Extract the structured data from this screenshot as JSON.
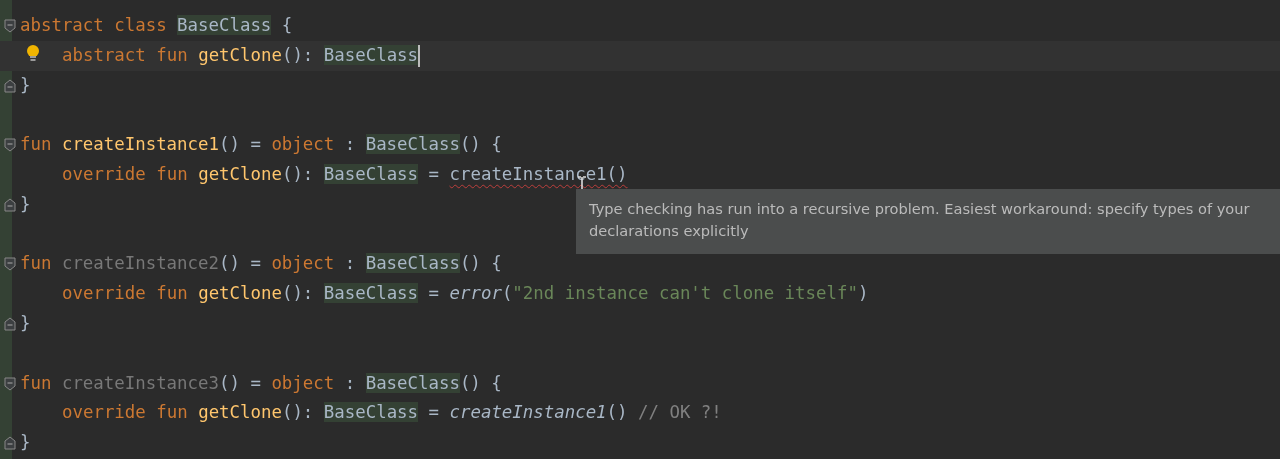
{
  "blocks": [
    {
      "header": {
        "tokens": [
          {
            "text": "abstract",
            "kind": "keyword"
          },
          {
            "text": "class",
            "kind": "keyword",
            "spaced": true
          },
          {
            "text": "BaseClass",
            "kind": "type",
            "spaced": true
          },
          {
            "text": "{",
            "kind": "plain",
            "spaced": true
          }
        ]
      },
      "children": [
        {
          "current": true,
          "hint": true,
          "tokens": [
            {
              "text": "abstract",
              "kind": "keyword"
            },
            {
              "text": "fun",
              "kind": "keyword",
              "spaced": true
            },
            {
              "text": "getClone",
              "kind": "decl",
              "spaced": true
            },
            {
              "text": "():",
              "kind": "plain"
            },
            {
              "text": "BaseClass",
              "kind": "type",
              "spaced": true
            }
          ]
        }
      ],
      "footer": {
        "tokens": [
          {
            "text": "}",
            "kind": "plain"
          }
        ]
      }
    },
    {
      "header": {
        "tokens": [
          {
            "text": "fun",
            "kind": "keyword"
          },
          {
            "text": "createInstance1",
            "kind": "decl",
            "spaced": true
          },
          {
            "text": "()",
            "kind": "plain"
          },
          {
            "text": "=",
            "kind": "plain",
            "spaced": true
          },
          {
            "text": "object",
            "kind": "keyword",
            "spaced": true
          },
          {
            "text": ":",
            "kind": "plain",
            "spaced": true
          },
          {
            "text": "BaseClass",
            "kind": "type",
            "spaced": true
          },
          {
            "text": "()",
            "kind": "plain"
          },
          {
            "text": "{",
            "kind": "plain",
            "spaced": true
          }
        ]
      },
      "children": [
        {
          "current": false,
          "hint": false,
          "tokens": [
            {
              "text": "override",
              "kind": "keyword"
            },
            {
              "text": "fun",
              "kind": "keyword",
              "spaced": true
            },
            {
              "text": "getClone",
              "kind": "decl",
              "spaced": true
            },
            {
              "text": "():",
              "kind": "plain"
            },
            {
              "text": "BaseClass",
              "kind": "type",
              "spaced": true
            },
            {
              "text": "=",
              "kind": "plain",
              "spaced": true
            },
            {
              "text": "createInstance1()",
              "kind": "error-call",
              "spaced": true
            }
          ]
        }
      ],
      "footer": {
        "tokens": [
          {
            "text": "}",
            "kind": "plain"
          }
        ]
      }
    },
    {
      "header": {
        "tokens": [
          {
            "text": "fun",
            "kind": "keyword"
          },
          {
            "text": "createInstance2",
            "kind": "unused",
            "spaced": true
          },
          {
            "text": "()",
            "kind": "plain"
          },
          {
            "text": "=",
            "kind": "plain",
            "spaced": true
          },
          {
            "text": "object",
            "kind": "keyword",
            "spaced": true
          },
          {
            "text": ":",
            "kind": "plain",
            "spaced": true
          },
          {
            "text": "BaseClass",
            "kind": "type",
            "spaced": true
          },
          {
            "text": "()",
            "kind": "plain"
          },
          {
            "text": "{",
            "kind": "plain",
            "spaced": true
          }
        ]
      },
      "children": [
        {
          "current": false,
          "hint": false,
          "tokens": [
            {
              "text": "override",
              "kind": "keyword"
            },
            {
              "text": "fun",
              "kind": "keyword",
              "spaced": true
            },
            {
              "text": "getClone",
              "kind": "decl",
              "spaced": true
            },
            {
              "text": "():",
              "kind": "plain"
            },
            {
              "text": "BaseClass",
              "kind": "type",
              "spaced": true
            },
            {
              "text": "=",
              "kind": "plain",
              "spaced": true
            },
            {
              "text": "error",
              "kind": "call",
              "spaced": true
            },
            {
              "text": "(",
              "kind": "plain"
            },
            {
              "text": "\"2nd instance can't clone itself\"",
              "kind": "string"
            },
            {
              "text": ")",
              "kind": "plain"
            }
          ]
        }
      ],
      "footer": {
        "tokens": [
          {
            "text": "}",
            "kind": "plain"
          }
        ]
      }
    },
    {
      "header": {
        "tokens": [
          {
            "text": "fun",
            "kind": "keyword"
          },
          {
            "text": "createInstance3",
            "kind": "unused",
            "spaced": true
          },
          {
            "text": "()",
            "kind": "plain"
          },
          {
            "text": "=",
            "kind": "plain",
            "spaced": true
          },
          {
            "text": "object",
            "kind": "keyword",
            "spaced": true
          },
          {
            "text": ":",
            "kind": "plain",
            "spaced": true
          },
          {
            "text": "BaseClass",
            "kind": "type",
            "spaced": true
          },
          {
            "text": "()",
            "kind": "plain"
          },
          {
            "text": "{",
            "kind": "plain",
            "spaced": true
          }
        ]
      },
      "children": [
        {
          "current": false,
          "hint": false,
          "tokens": [
            {
              "text": "override",
              "kind": "keyword"
            },
            {
              "text": "fun",
              "kind": "keyword",
              "spaced": true
            },
            {
              "text": "getClone",
              "kind": "decl",
              "spaced": true
            },
            {
              "text": "():",
              "kind": "plain"
            },
            {
              "text": "BaseClass",
              "kind": "type",
              "spaced": true
            },
            {
              "text": "=",
              "kind": "plain",
              "spaced": true
            },
            {
              "text": "createInstance1",
              "kind": "call",
              "spaced": true
            },
            {
              "text": "()",
              "kind": "plain"
            },
            {
              "text": "// OK ?!",
              "kind": "comment",
              "spaced": true
            }
          ]
        }
      ],
      "footer": {
        "tokens": [
          {
            "text": "}",
            "kind": "plain"
          }
        ]
      }
    }
  ],
  "tooltip": {
    "text": "Type checking has run into a recursive problem. Easiest workaround: specify types of your declarations explicitly"
  }
}
